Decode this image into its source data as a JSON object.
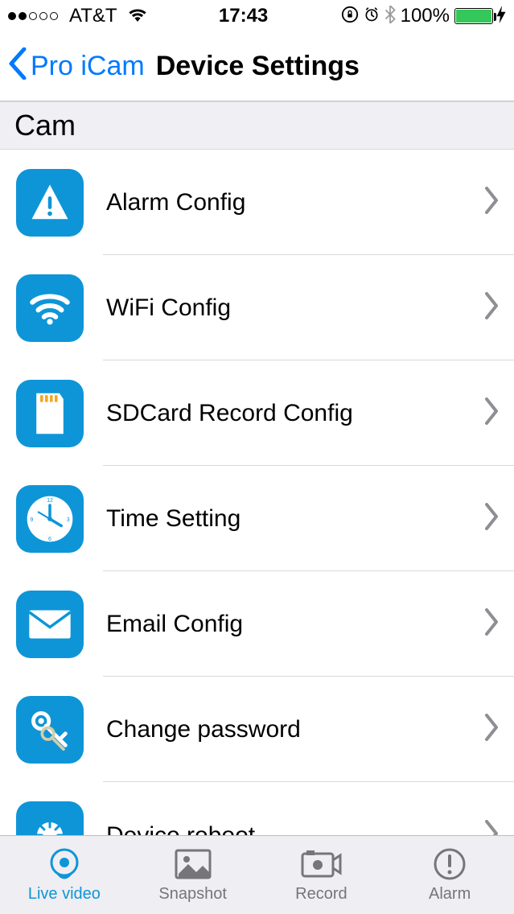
{
  "status_bar": {
    "carrier": "AT&T",
    "time": "17:43",
    "battery_pct": "100%"
  },
  "nav": {
    "back_label": "Pro iCam",
    "title": "Device Settings"
  },
  "section": {
    "title": "Cam"
  },
  "rows": [
    {
      "label": "Alarm Config",
      "icon": "alert"
    },
    {
      "label": "WiFi Config",
      "icon": "wifi"
    },
    {
      "label": "SDCard Record Config",
      "icon": "sdcard"
    },
    {
      "label": "Time Setting",
      "icon": "clock"
    },
    {
      "label": "Email Config",
      "icon": "mail"
    },
    {
      "label": "Change password",
      "icon": "key"
    },
    {
      "label": "Device reboot",
      "icon": "reboot"
    }
  ],
  "tabs": [
    {
      "label": "Live video",
      "icon": "live",
      "active": true
    },
    {
      "label": "Snapshot",
      "icon": "snapshot",
      "active": false
    },
    {
      "label": "Record",
      "icon": "record",
      "active": false
    },
    {
      "label": "Alarm",
      "icon": "alarm",
      "active": false
    }
  ]
}
